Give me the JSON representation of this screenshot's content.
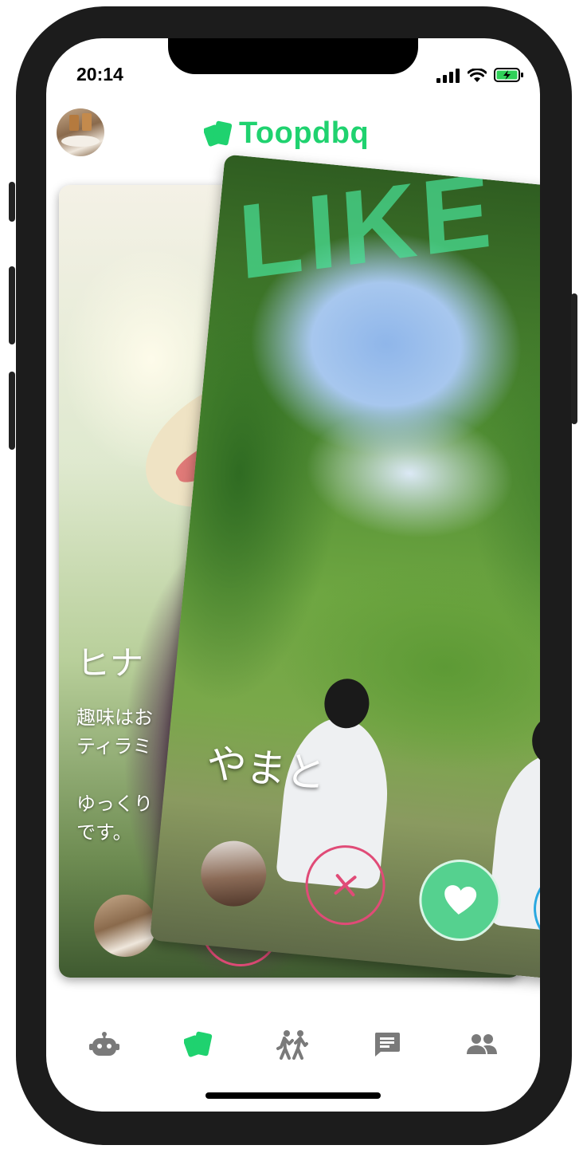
{
  "status_bar": {
    "time": "20:14"
  },
  "header": {
    "app_name": "Toopdbq",
    "brand_color": "#1fd26f"
  },
  "back_card": {
    "name": "ヒナ",
    "bio": "趣味はお\nティラミ\n\nゆっくり\nです。"
  },
  "front_card": {
    "stamp": "LIKE",
    "name": "やまと"
  },
  "colors": {
    "nope": "#e04b77",
    "like": "#55d18f",
    "boost": "#2aa8e0",
    "tab_active": "#1fd26f",
    "tab_inactive": "#7a7a7a"
  },
  "tabs": [
    {
      "icon": "bot-icon",
      "active": false
    },
    {
      "icon": "cards-icon",
      "active": true
    },
    {
      "icon": "activity-icon",
      "active": false
    },
    {
      "icon": "chat-icon",
      "active": false
    },
    {
      "icon": "people-icon",
      "active": false
    }
  ]
}
